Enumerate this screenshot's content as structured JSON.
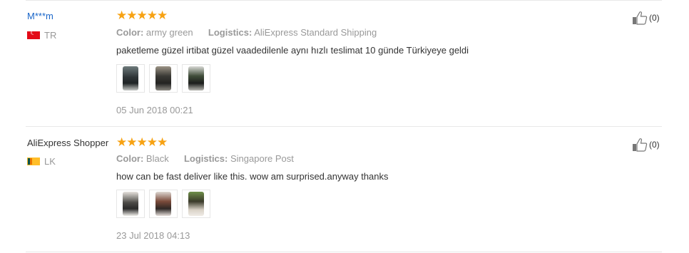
{
  "reviews": [
    {
      "user": "M***m",
      "country_code": "TR",
      "rating": 5,
      "stars": "★★★★★",
      "color_label": "Color:",
      "color_value": "army green",
      "logistics_label": "Logistics:",
      "logistics_value": "AliExpress Standard Shipping",
      "text": "paketleme güzel irtibat güzel vaadedilenle aynı hızlı teslimat 10 günde Türkiyeye geldi",
      "photos": 3,
      "date": "05 Jun 2018 00:21",
      "helpful_count": "(0)"
    },
    {
      "user": "AliExpress Shopper",
      "country_code": "LK",
      "rating": 5,
      "stars": "★★★★★",
      "color_label": "Color:",
      "color_value": "Black",
      "logistics_label": "Logistics:",
      "logistics_value": "Singapore Post",
      "text": "how can be fast deliver like this. wow am surprised.anyway thanks",
      "photos": 3,
      "date": "23 Jul 2018 04:13",
      "helpful_count": "(0)"
    }
  ],
  "colors": {
    "accent_star": "#f7a213",
    "link": "#1a66c9",
    "muted": "#999999"
  }
}
